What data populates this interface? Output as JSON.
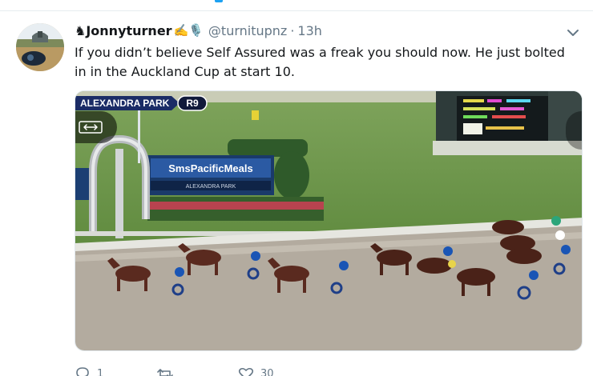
{
  "tweet": {
    "display_name": "♞Jonnyturner",
    "name_emojis": "✍️🎙️",
    "handle": "@turnitupnz",
    "separator": "·",
    "time": "13h",
    "text": "If you didn’t believe Self Assured was a freak you should now. He just bolted in in the Auckland Cup at start 10."
  },
  "media": {
    "track_name": "ALEXANDRA PARK",
    "race_number": "R9",
    "sponsor": "SmsPacificMeals",
    "sponsor_sub": "ALEXANDRA PARK"
  },
  "actions": {
    "reply_count": "1",
    "retweet_count": "",
    "like_count": "30"
  },
  "icons": {
    "caret": "chevron-down-icon",
    "expand": "expand-icon",
    "reply": "reply-icon",
    "retweet": "retweet-icon",
    "like": "heart-icon"
  },
  "colors": {
    "text": "#14171a",
    "secondary": "#657786",
    "accent": "#1da1f2"
  }
}
